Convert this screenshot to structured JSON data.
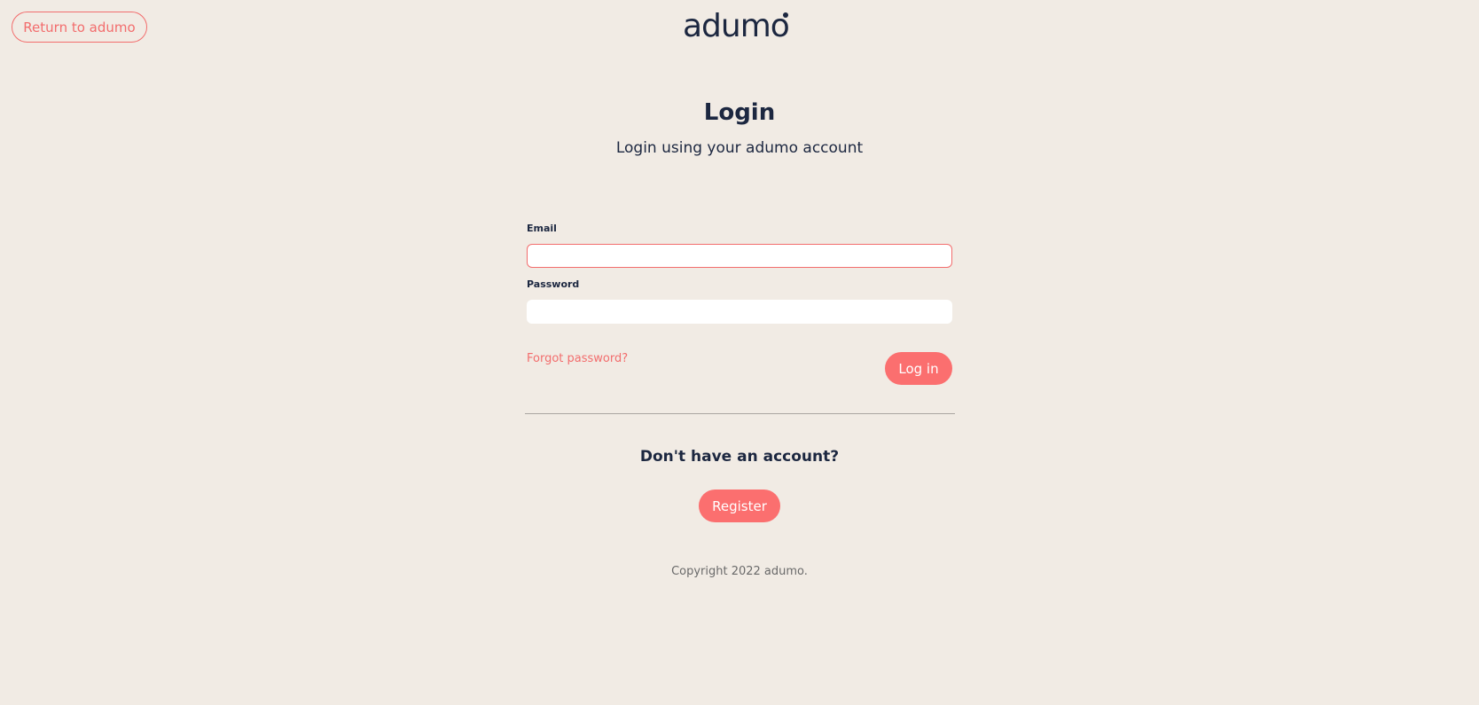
{
  "header": {
    "return_label": "Return to adumo",
    "logo_text": "adumo"
  },
  "form": {
    "title": "Login",
    "subtitle": "Login using your adumo account",
    "email_label": "Email",
    "email_value": "",
    "password_label": "Password",
    "password_value": "",
    "forgot_label": "Forgot password?",
    "login_label": "Log in"
  },
  "register": {
    "prompt": "Don't have an account?",
    "button_label": "Register"
  },
  "footer": {
    "copyright": "Copyright 2022 adumo."
  },
  "colors": {
    "background": "#f1ebe4",
    "accent": "#fb6f6f",
    "text": "#1c2740"
  }
}
